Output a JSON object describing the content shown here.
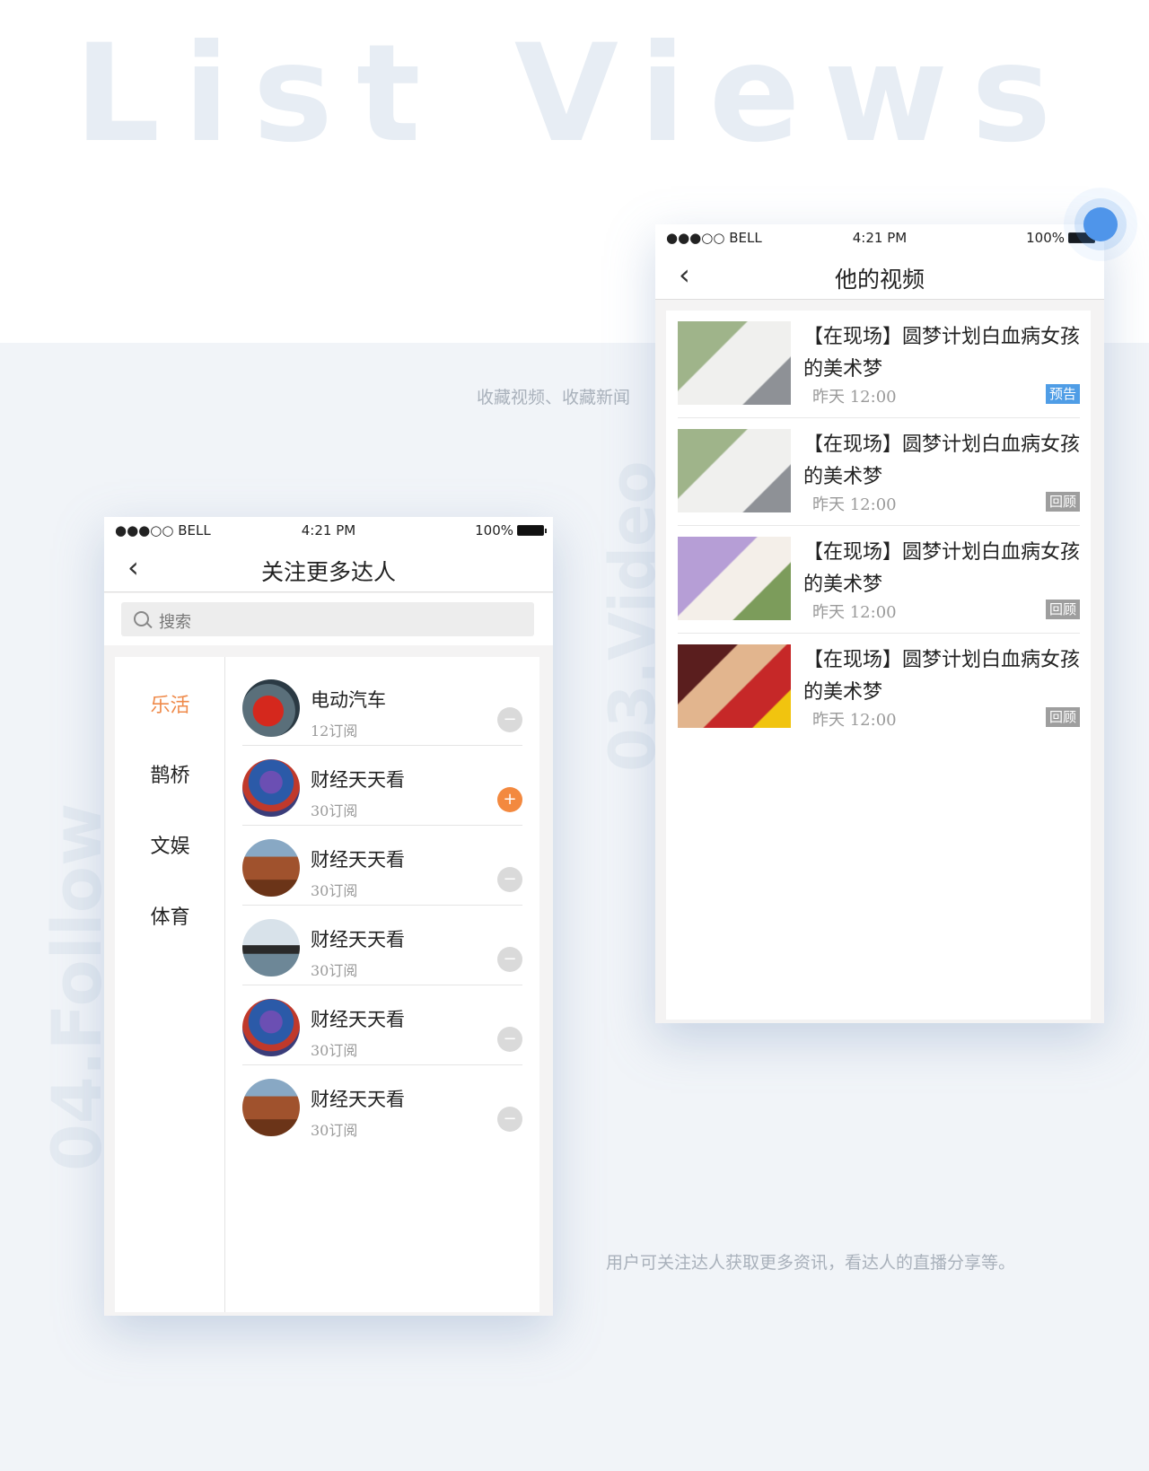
{
  "hero_title": "List Views",
  "vertical_labels": {
    "follow": "04.Follow",
    "video": "03.Video"
  },
  "captions": {
    "video": "收藏视频、收藏新闻",
    "follow": "用户可关注达人获取更多资讯，看达人的直播分享等。"
  },
  "status_bar": {
    "carrier": "●●●○○ BELL",
    "time": "4:21 PM",
    "battery": "100%"
  },
  "follow_screen": {
    "title": "关注更多达人",
    "search_placeholder": "搜索",
    "categories": [
      {
        "label": "乐活",
        "active": true
      },
      {
        "label": "鹊桥",
        "active": false
      },
      {
        "label": "文娱",
        "active": false
      },
      {
        "label": "体育",
        "active": false
      }
    ],
    "items": [
      {
        "name": "电动汽车",
        "subs": "12订阅",
        "action": "−",
        "avatar": "car"
      },
      {
        "name": "财经天天看",
        "subs": "30订阅",
        "action": "+",
        "avatar": "stock"
      },
      {
        "name": "财经天天看",
        "subs": "30订阅",
        "action": "−",
        "avatar": "rock"
      },
      {
        "name": "财经天天看",
        "subs": "30订阅",
        "action": "−",
        "avatar": "person"
      },
      {
        "name": "财经天天看",
        "subs": "30订阅",
        "action": "−",
        "avatar": "stock"
      },
      {
        "name": "财经天天看",
        "subs": "30订阅",
        "action": "−",
        "avatar": "rock"
      }
    ]
  },
  "video_screen": {
    "title": "他的视频",
    "items": [
      {
        "title": "【在现场】圆梦计划白血病女孩的美术梦",
        "time": "昨天 12:00",
        "badge": "预告",
        "thumb": "girl1"
      },
      {
        "title": "【在现场】圆梦计划白血病女孩的美术梦",
        "time": "昨天 12:00",
        "badge": "回顾",
        "thumb": "girl1"
      },
      {
        "title": "【在现场】圆梦计划白血病女孩的美术梦",
        "time": "昨天 12:00",
        "badge": "回顾",
        "thumb": "girl2"
      },
      {
        "title": "【在现场】圆梦计划白血病女孩的美术梦",
        "time": "昨天 12:00",
        "badge": "回顾",
        "thumb": "girl3"
      }
    ]
  },
  "colors": {
    "accent_orange": "#ef8a4a",
    "accent_blue": "#4f9de6",
    "badge_gray": "#9e9e9e"
  }
}
